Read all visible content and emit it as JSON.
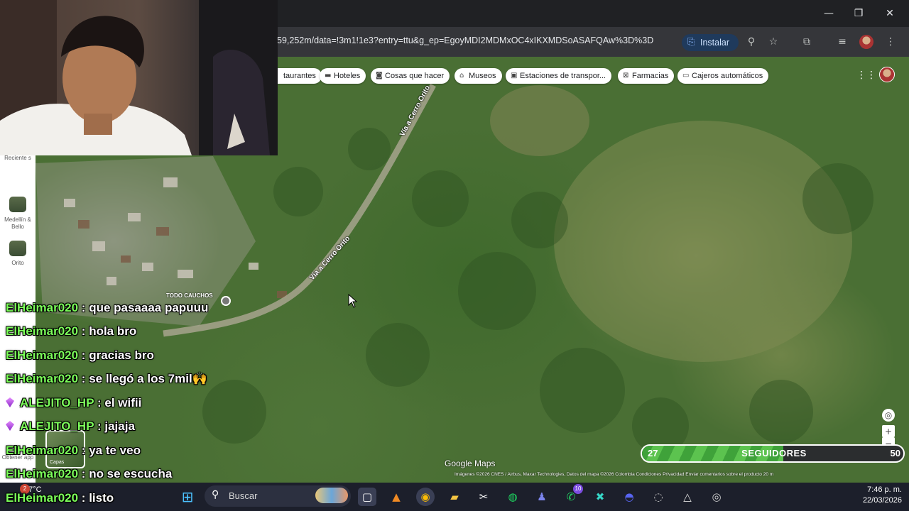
{
  "browser": {
    "url": "59,252m/data=!3m1!1e3?entry=ttu&g_ep=EgoyMDI2MDMxOC4xIKXMDSoASAFQAw%3D%3D",
    "install_label": "Instalar",
    "window_controls": [
      "minimize-icon",
      "restore-icon",
      "close-icon"
    ]
  },
  "map": {
    "chips": [
      {
        "label": "taurantes",
        "icon": ""
      },
      {
        "label": "Hoteles",
        "icon": "bed-icon"
      },
      {
        "label": "Cosas que hacer",
        "icon": "camera-icon"
      },
      {
        "label": "Museos",
        "icon": "museum-icon"
      },
      {
        "label": "Estaciones de transpor...",
        "icon": "transit-icon"
      },
      {
        "label": "Farmacias",
        "icon": "pharmacy-icon"
      },
      {
        "label": "Cajeros automáticos",
        "icon": "atm-icon"
      }
    ],
    "road_label": "Vía a Cerro Orito",
    "poi_label": "TODO CAUCHOS",
    "logo": "Google Maps",
    "footer": "Imágenes ©2026 CNES / Airbus, Maxar Technologies, Datos del mapa ©2026   Colombia   Condiciones   Privacidad   Enviar comentarios sobre el producto   20 m",
    "sidebar": {
      "recents_label": "Reciente s",
      "item1_label": "Medellín & Bello",
      "item2_label": "Orito",
      "item3_label": "Obtener app",
      "layers_label": "Capas"
    }
  },
  "chat": {
    "messages": [
      {
        "user": "ElHeimar020",
        "text": "que pasaaaa papuuu",
        "badge": false
      },
      {
        "user": "ElHeimar020",
        "text": "hola bro",
        "badge": false
      },
      {
        "user": "ElHeimar020",
        "text": "gracias bro",
        "badge": false
      },
      {
        "user": "ElHeimar020",
        "text": "se llegó a los 7mil🙌",
        "badge": false
      },
      {
        "user": "ALEJITO_HP",
        "text": "el wifii",
        "badge": true
      },
      {
        "user": "ALEJITO_HP",
        "text": "jajaja",
        "badge": true
      },
      {
        "user": "ElHeimar020",
        "text": "ya te veo",
        "badge": false
      },
      {
        "user": "ElHeimar020",
        "text": "no se escucha",
        "badge": false
      },
      {
        "user": "ElHeimar020",
        "text": "listo",
        "badge": false
      }
    ]
  },
  "followers": {
    "current": "27",
    "goal": "50",
    "label": "SEGUIDORES",
    "progress": 0.54
  },
  "taskbar": {
    "weather": "27°C",
    "search_placeholder": "Buscar",
    "time": "7:46 p. m.",
    "date": "22/03/2026",
    "teams_badge": "10",
    "weather_badge": "2"
  },
  "colors": {
    "chat_user": "#7cff5a",
    "followers_fill": "#4caf3f",
    "taskbar": "#1c1f2b"
  }
}
